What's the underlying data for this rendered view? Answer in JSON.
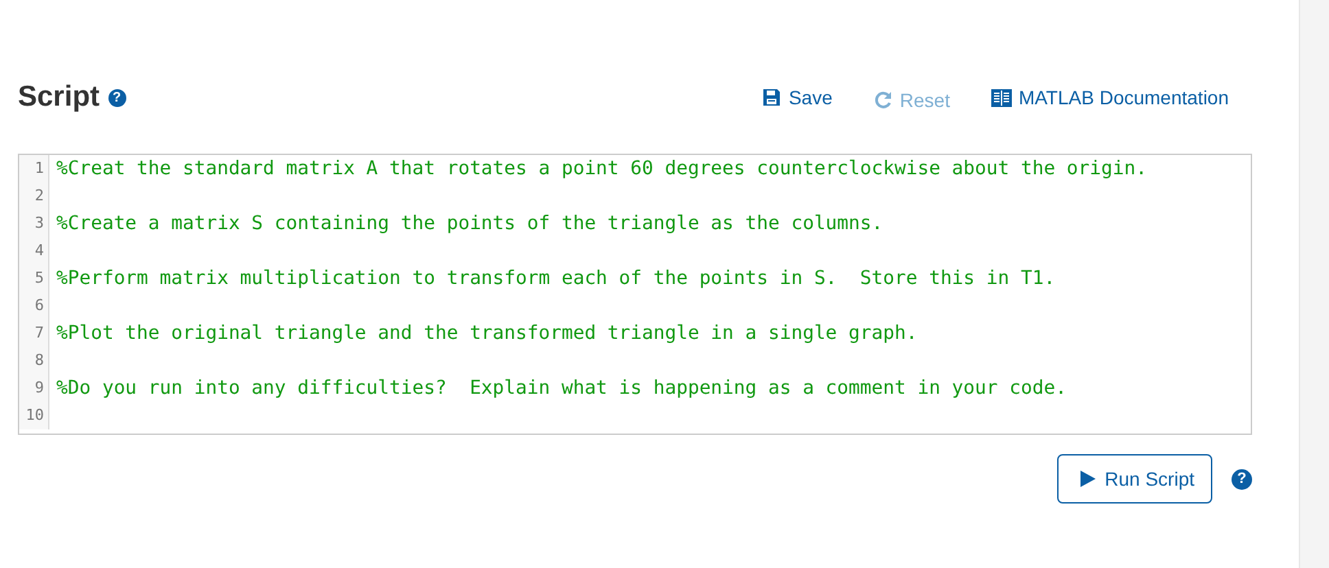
{
  "header": {
    "title": "Script",
    "help": "?"
  },
  "toolbar": [
    {
      "kind": "save",
      "label": "Save",
      "disabled": false
    },
    {
      "kind": "reset",
      "label": "Reset",
      "disabled": true
    },
    {
      "kind": "docs",
      "label": "MATLAB Documentation",
      "disabled": false
    }
  ],
  "editor": {
    "lines": [
      {
        "number": "1",
        "text": "%Creat the standard matrix A that rotates a point 60 degrees counterclockwise about the origin."
      },
      {
        "number": "2"
      },
      {
        "number": "3",
        "text": "%Create a matrix S containing the points of the triangle as the columns."
      },
      {
        "number": "4"
      },
      {
        "number": "5",
        "text": "%Perform matrix multiplication to transform each of the points in S.  Store this in T1."
      },
      {
        "number": "6"
      },
      {
        "number": "7",
        "text": "%Plot the original triangle and the transformed triangle in a single graph."
      },
      {
        "number": "8"
      },
      {
        "number": "9",
        "text": "%Do you run into any difficulties?  Explain what is happening as a comment in your code."
      },
      {
        "number": "10"
      }
    ]
  },
  "footer": {
    "run_button": "Run Script",
    "help": "?"
  }
}
